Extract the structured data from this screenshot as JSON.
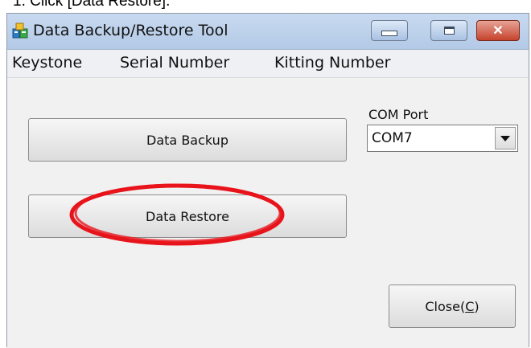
{
  "caption": "1.   Click [Data Restore].",
  "window": {
    "title": "Data Backup/Restore Tool",
    "close_glyph": "✕"
  },
  "menu": [
    "Keystone",
    "Serial Number",
    "Kitting Number"
  ],
  "buttons": {
    "backup": "Data Backup",
    "restore": "Data Restore",
    "close_prefix": "Close(",
    "close_mnemonic": "C",
    "close_suffix": ")"
  },
  "com_port": {
    "label": "COM Port",
    "value": "COM7"
  },
  "colors": {
    "highlight_ring": "#e8141b",
    "titlebar": "#c8daf0"
  },
  "icons": {
    "app": "app-icon",
    "dropdown": "chevron-down-icon"
  }
}
